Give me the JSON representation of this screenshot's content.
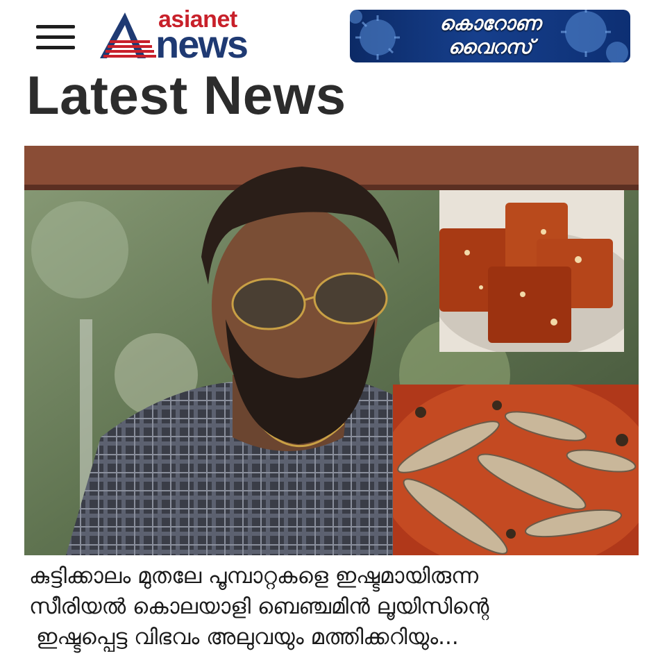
{
  "header": {
    "menu_icon": "hamburger-menu-icon",
    "logo": {
      "small_text": "asianet",
      "big_text": "news",
      "icon": "asianet-a-logo-icon",
      "colors": {
        "small": "#c8202a",
        "big": "#1f3a73"
      }
    },
    "banner": {
      "line1": "കൊറോണ",
      "line2": "വൈറസ്",
      "icon": "virus-icon",
      "color": "#163f8c"
    }
  },
  "section": {
    "title": "Latest News"
  },
  "article": {
    "headline_lines": [
      "കുട്ടിക്കാലം മുതലേ പൂമ്പാറ്റകളെ ഇഷ്ടമായിരുന്ന",
      "സീരിയൽ കൊലയാളി ബെഞ്ചമിൻ ലൂയിസിന്റെ",
      "ഇഷ്ടപ്പെട്ട വിഭവം അലുവയും മത്തിക്കറിയും..."
    ]
  }
}
